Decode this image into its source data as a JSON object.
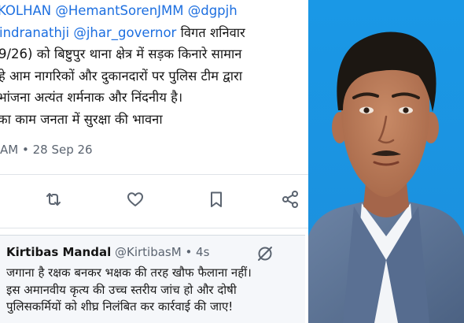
{
  "tweet": {
    "lines": [
      {
        "mentions": "KOLHAN @HemantSorenJMM @dgpjh"
      },
      {
        "mentions": "indranathji @jhar_governor",
        "text": " विगत शनिवार"
      },
      {
        "text": "9/26) को बिष्टुपुर थाना क्षेत्र में सड़क किनारे सामान"
      },
      {
        "text": "हे आम नागरिकों और  दुकानदारों पर पुलिस टीम द्वारा"
      },
      {
        "text": " भांजना अत्यंत शर्मनाक और निंदनीय है।"
      },
      {
        "text": "का काम जनता में सुरक्षा की भावना"
      }
    ],
    "timestamp": "AM • 28 Sep 26"
  },
  "actions": [
    {
      "icon": "retweet-icon"
    },
    {
      "icon": "heart-icon"
    },
    {
      "icon": "bookmark-icon"
    },
    {
      "icon": "share-icon"
    }
  ],
  "reply": {
    "name": "Kirtibas Mandal",
    "handle": " @KirtibasM • 4s",
    "lines": [
      "जगाना है रक्षक बनकर भक्षक की तरह खौफ फैलाना नहीं।",
      "इस अमानवीय कृत्य की उच्च स्तरीय जांच हो और दोषी",
      "पुलिसकर्मियों को शीघ्र निलंबित कर कार्रवाई की जाए!"
    ]
  },
  "colors": {
    "link": "#1d6fe0",
    "photo_background": "#1e9be6",
    "icon": "#5b6470"
  },
  "photo": {
    "icon": "person-photo"
  }
}
